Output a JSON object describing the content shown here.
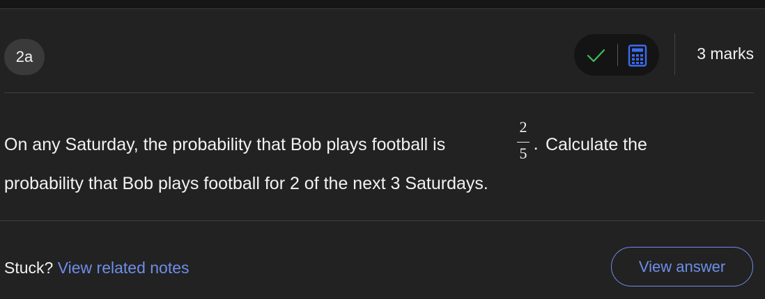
{
  "question": {
    "number": "2a",
    "marks": "3 marks",
    "text_line1_before": "On any Saturday, the probability that Bob plays football is",
    "fraction": {
      "numerator": "2",
      "denominator": "5"
    },
    "text_line1_after": ". ",
    "text_line1_cont": "Calculate the",
    "text_line2": "probability that Bob plays football for 2 of the next 3 Saturdays."
  },
  "tools": {
    "icons": [
      "check-icon",
      "calculator-icon"
    ],
    "check_color": "#3fbf5a",
    "calculator_color": "#3b6cf0"
  },
  "footer": {
    "stuck_label": "Stuck?",
    "notes_link": "View related notes",
    "answer_button": "View answer"
  },
  "colors": {
    "background": "#222222",
    "accent": "#6e8ee8"
  }
}
